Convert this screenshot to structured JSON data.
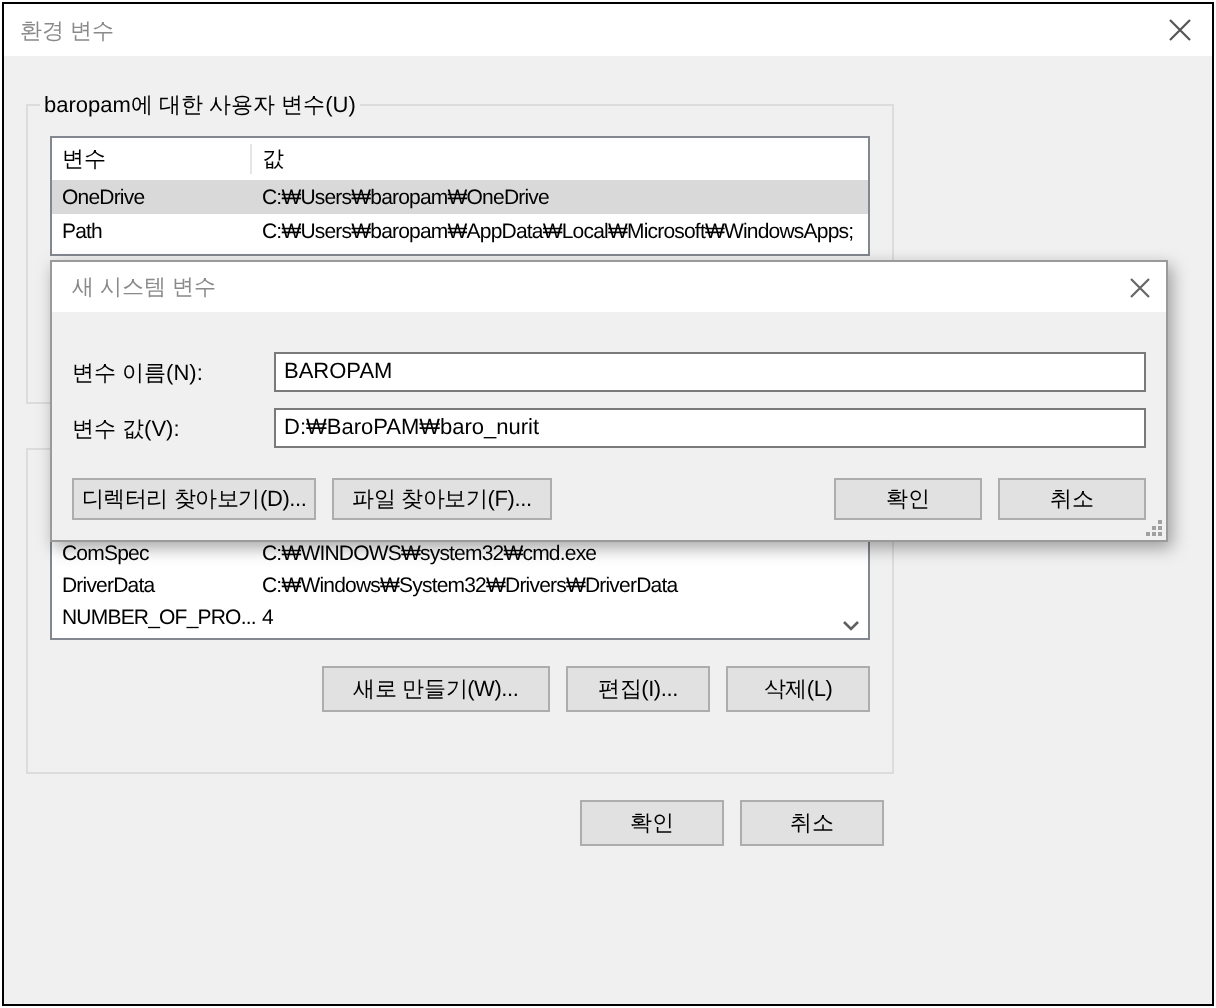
{
  "window": {
    "title": "환경 변수"
  },
  "user_variables": {
    "label": "baropam에 대한 사용자 변수(U)",
    "columns": [
      "변수",
      "값"
    ],
    "rows": [
      {
        "name": "OneDrive",
        "value": "C:₩Users₩baropam₩OneDrive",
        "selected": true
      },
      {
        "name": "Path",
        "value": "C:₩Users₩baropam₩AppData₩Local₩Microsoft₩WindowsApps;",
        "selected": false
      }
    ]
  },
  "system_variables": {
    "rows": [
      {
        "name": "ComSpec",
        "value": "C:₩WINDOWS₩system32₩cmd.exe",
        "selected": false
      },
      {
        "name": "DriverData",
        "value": "C:₩Windows₩System32₩Drivers₩DriverData",
        "selected": false
      },
      {
        "name": "NUMBER_OF_PRO...",
        "value": "4",
        "selected": false
      }
    ],
    "buttons": [
      "새로 만들기(W)...",
      "편집(I)...",
      "삭제(L)"
    ]
  },
  "buttons": [
    "확인",
    "취소"
  ],
  "dialog": {
    "title": "새 시스템 변수",
    "fields": [
      {
        "label": "변수 이름(N):",
        "value": "BAROPAM"
      },
      {
        "label": "변수 값(V):",
        "value": "D:₩BaroPAM₩baro_nurit"
      }
    ],
    "browse_buttons": [
      "디렉터리 찾아보기(D)...",
      "파일 찾아보기(F)..."
    ],
    "buttons": [
      "확인",
      "취소"
    ]
  }
}
